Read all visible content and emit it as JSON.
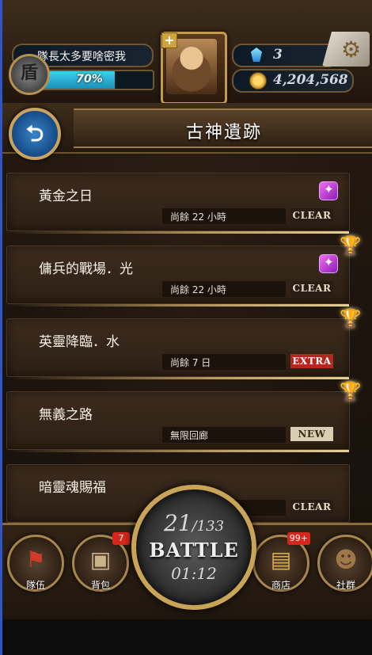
{
  "header": {
    "username": "隊長太多要啥密我",
    "exp_percent_text": "70%",
    "exp_fraction": 0.7,
    "rank_glyph": "盾",
    "gems": "3",
    "gold": "4,204,568",
    "plus_glyph": "+",
    "settings_glyph": "⚙"
  },
  "title_bar": {
    "back_glyph": "⮌",
    "title": "古神遺跡"
  },
  "dungeons": [
    {
      "name": "黃金之日",
      "time": "尚餘 22 小時",
      "status": "CLEAR",
      "status_type": "clear",
      "element": true,
      "trophy": false
    },
    {
      "name": "傭兵的戰場．光",
      "time": "尚餘 22 小時",
      "status": "CLEAR",
      "status_type": "clear",
      "element": true,
      "trophy": true
    },
    {
      "name": "英靈降臨．水",
      "time": "尚餘 7 日",
      "status": "EXTRA",
      "status_type": "extra",
      "element": false,
      "trophy": true
    },
    {
      "name": "無義之路",
      "time": "無限回廊",
      "status": "NEW",
      "status_type": "new",
      "element": false,
      "trophy": true
    },
    {
      "name": "暗靈魂賜福",
      "time": "",
      "status": "CLEAR",
      "status_type": "clear",
      "element": false,
      "trophy": false
    }
  ],
  "bottom_nav": {
    "team_label": "隊伍",
    "bag_label": "背包",
    "bag_badge": "7",
    "shop_label": "商店",
    "shop_badge": "99+",
    "social_label": "社群",
    "battle": {
      "stamina_current": "21",
      "stamina_max": "/133",
      "label": "BATTLE",
      "timer": "01:12"
    }
  },
  "colors": {
    "accent_gold": "#c9a356",
    "exp_blue": "#3fd0f4",
    "extra_red": "#b02a1e",
    "new_beige": "#d9cdb4"
  }
}
